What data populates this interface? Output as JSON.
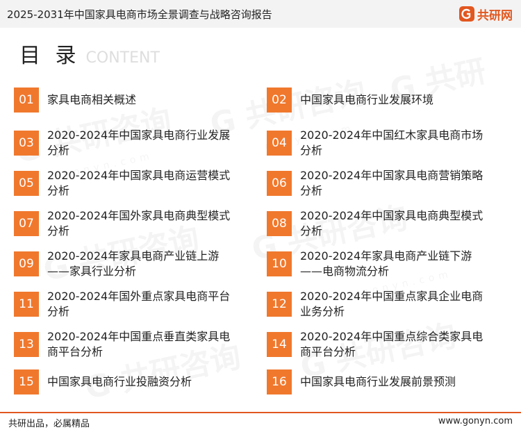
{
  "header": {
    "title": "2025-2031年中国家具电商市场全景调查与战略咨询报告",
    "logo_text": "共研网"
  },
  "toc": {
    "title": "目 录",
    "subtitle": "CONTENT"
  },
  "items": [
    {
      "num": "01",
      "text": "家具电商相关概述"
    },
    {
      "num": "02",
      "text": "中国家具电商行业发展环境"
    },
    {
      "num": "03",
      "text": "2020-2024年中国家具电商行业发展分析"
    },
    {
      "num": "04",
      "text": "2020-2024年中国红木家具电商市场分析"
    },
    {
      "num": "05",
      "text": "2020-2024年中国家具电商运营模式分析"
    },
    {
      "num": "06",
      "text": "2020-2024年中国家具电商营销策略分析"
    },
    {
      "num": "07",
      "text": "2020-2024年国外家具电商典型模式分析"
    },
    {
      "num": "08",
      "text": "2020-2024年中国家具电商典型模式分析"
    },
    {
      "num": "09",
      "text": "2020-2024年家具电商产业链上游——家具行业分析"
    },
    {
      "num": "10",
      "text": "2020-2024年家具电商产业链下游——电商物流分析"
    },
    {
      "num": "11",
      "text": "2020-2024年国外重点家具电商平台分析"
    },
    {
      "num": "12",
      "text": "2020-2024年中国重点家具企业电商业务分析"
    },
    {
      "num": "13",
      "text": "2020-2024年中国重点垂直类家具电商平台分析"
    },
    {
      "num": "14",
      "text": "2020-2024年中国重点综合类家具电商平台分析"
    },
    {
      "num": "15",
      "text": "中国家具电商行业投融资分析"
    },
    {
      "num": "16",
      "text": "中国家具电商行业发展前景预测"
    }
  ],
  "footer": {
    "left": "共研出品，必属精品",
    "right": "www.gonyn.com"
  },
  "colors": {
    "accent": "#f0782d",
    "brand": "#e2571f",
    "header_bg": "#f3f3f3"
  }
}
